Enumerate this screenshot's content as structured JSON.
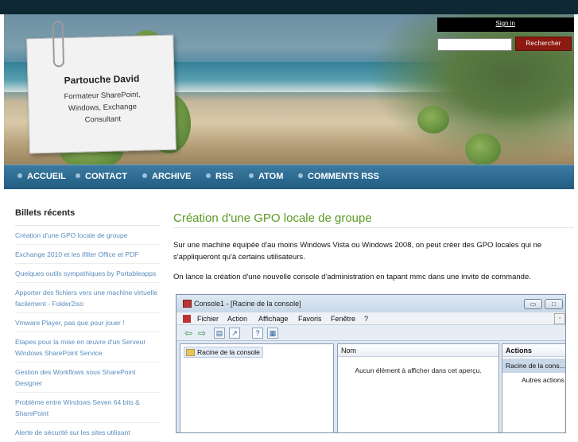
{
  "site": {
    "author_name": "Partouche David",
    "author_role": "Formateur SharePoint, Windows, Exchange Consultant",
    "sign_in": "Sign in",
    "search_placeholder": "",
    "search_button": "Rechercher"
  },
  "nav": {
    "items": [
      {
        "label": "ACCUEIL"
      },
      {
        "label": "CONTACT"
      },
      {
        "label": "ARCHIVE"
      },
      {
        "label": "RSS"
      },
      {
        "label": "ATOM"
      },
      {
        "label": "COMMENTS RSS"
      }
    ]
  },
  "sidebar": {
    "heading": "Billets récents",
    "items": [
      "Création d'une GPO locale de groupe",
      "Exchange 2010 et les ifilter Office et PDF",
      "Quelques outils sympathiques by Portableapps",
      "Apporter des fichiers vers une machine virtuelle facilement - Folder2iso",
      "Vmware Player, pas que pour jouer !",
      "Etapes pour la mise en œuvre d'un Serveur Windows SharePoint Service",
      "Gestion des Workflows sous SharePoint Designer",
      "Problème entre Windows Seven 64 bits & SharePoint",
      "Alerte de sécurité sur les sites utilisant"
    ]
  },
  "post": {
    "title": "Création d'une GPO locale de groupe",
    "p1": "Sur une machine équipée d'au moins Windows Vista ou Windows 2008, on peut créer des GPO locales qui ne s'appliqueront qu'à certains utilisateurs.",
    "p2": "On lance la création d'une nouvelle console d'administration en tapant mmc dans une invite de commande."
  },
  "screenshot": {
    "title": "Console1 - [Racine de la console]",
    "menu": [
      "Fichier",
      "Action",
      "Affichage",
      "Favoris",
      "Fenêtre",
      "?"
    ],
    "tree_item": "Racine de la console",
    "col_name": "Nom",
    "empty_text": "Aucun élément à afficher dans cet aperçu.",
    "actions_header": "Actions",
    "actions_sub": "Racine de la cons...",
    "actions_item": "Autres actions"
  },
  "colors": {
    "nav_bg": "#2c6a91",
    "title_green": "#5c9a22",
    "link_blue": "#5a8dbe",
    "search_button": "#8d1a10"
  }
}
